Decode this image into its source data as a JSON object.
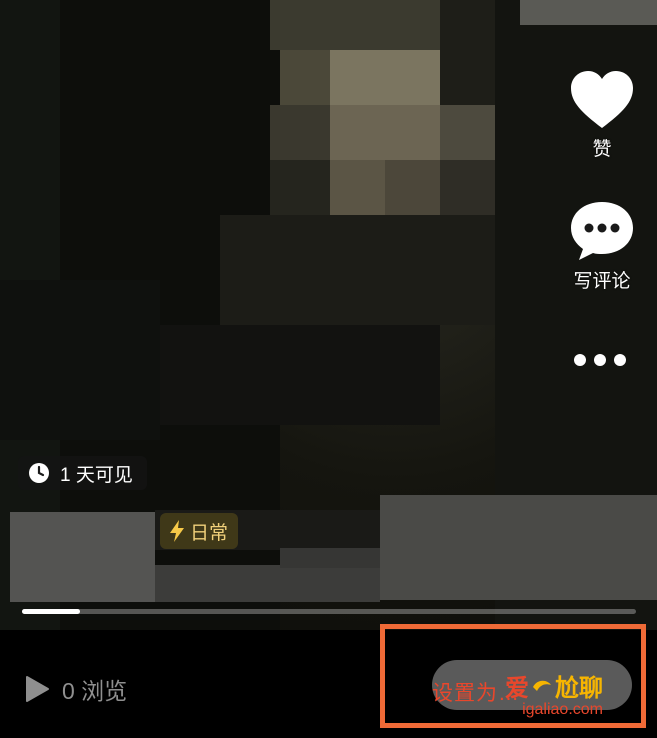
{
  "actions": {
    "like_label": "赞",
    "comment_label": "写评论"
  },
  "visibility": {
    "label": "1 天可见"
  },
  "tag": {
    "label": "日常"
  },
  "progress": {
    "fraction": 0.095
  },
  "bottom": {
    "views_label": "0 浏览",
    "set_label": "设置为…",
    "watermark_text_1": "爱",
    "watermark_text_2": "尬聊",
    "watermark_url": "igaliao.com"
  },
  "colors": {
    "highlight": "#ef6a37",
    "tag_text": "#f0d07a",
    "watermark_red": "#e8472c"
  }
}
